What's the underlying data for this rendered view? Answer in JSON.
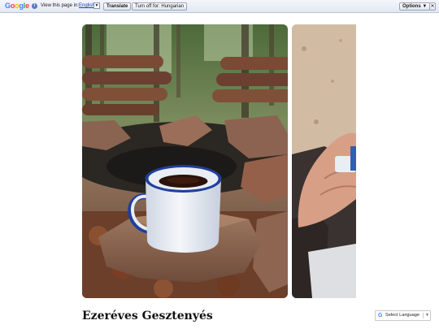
{
  "translate_bar": {
    "logo": [
      "G",
      "o",
      "o",
      "g",
      "l",
      "e"
    ],
    "info_icon": "i",
    "view_text": "View this page in:",
    "language": "English",
    "language_arrow": "▼",
    "translate_button": "Translate",
    "turn_off_button": "Turn off for: Hungarian",
    "options_button": "Options ▼",
    "close_button": "✕"
  },
  "gallery": {
    "main_photo": "enamel-mug-coffee-on-rock-in-forest",
    "side_photo": "hand-holding-thermos"
  },
  "post": {
    "title": "Ezeréves Gesztenyés"
  },
  "language_widget": {
    "icon": "G",
    "label": "Select Language",
    "arrow": "▼"
  }
}
